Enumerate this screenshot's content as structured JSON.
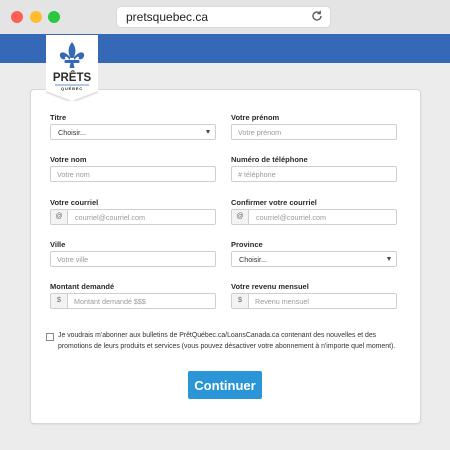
{
  "browser": {
    "url": "pretsquebec.ca"
  },
  "logo": {
    "brand": "PRÊTS",
    "sub": "QUÉBEC",
    "colors": {
      "fleur": "#3568b7",
      "tab": "#ffffff"
    }
  },
  "colors": {
    "banner": "#3568b7",
    "button": "#2a96d7"
  },
  "form": {
    "titre_label": "Titre",
    "titre_value": "Choisir...",
    "prenom_label": "Votre prénom",
    "prenom_placeholder": "Votre prénom",
    "nom_label": "Votre nom",
    "nom_placeholder": "Votre nom",
    "tel_label": "Numéro de téléphone",
    "tel_placeholder": "# téléphone",
    "courriel_label": "Votre courriel",
    "courriel_addon": "@",
    "courriel_placeholder": "courriel@courriel.com",
    "confirm_label": "Confirmer votre courriel",
    "confirm_addon": "@",
    "confirm_placeholder": "courriel@courriel.com",
    "ville_label": "Ville",
    "ville_placeholder": "Votre ville",
    "province_label": "Province",
    "province_value": "Choisir...",
    "montant_label": "Montant demandé",
    "montant_addon": "$",
    "montant_placeholder": "Montant demandé $$$",
    "revenu_label": "Votre revenu mensuel",
    "revenu_addon": "$",
    "revenu_placeholder": "Revenu mensuel",
    "consent_text": "Je voudrais m'abonner aux bulletins de PrêtQuébec.ca/LoansCanada.ca contenant des nouvelles et des promotions de leurs produits et services (vous pouvez désactiver votre abonnement à n'importe quel moment).",
    "submit_label": "Continuer"
  }
}
